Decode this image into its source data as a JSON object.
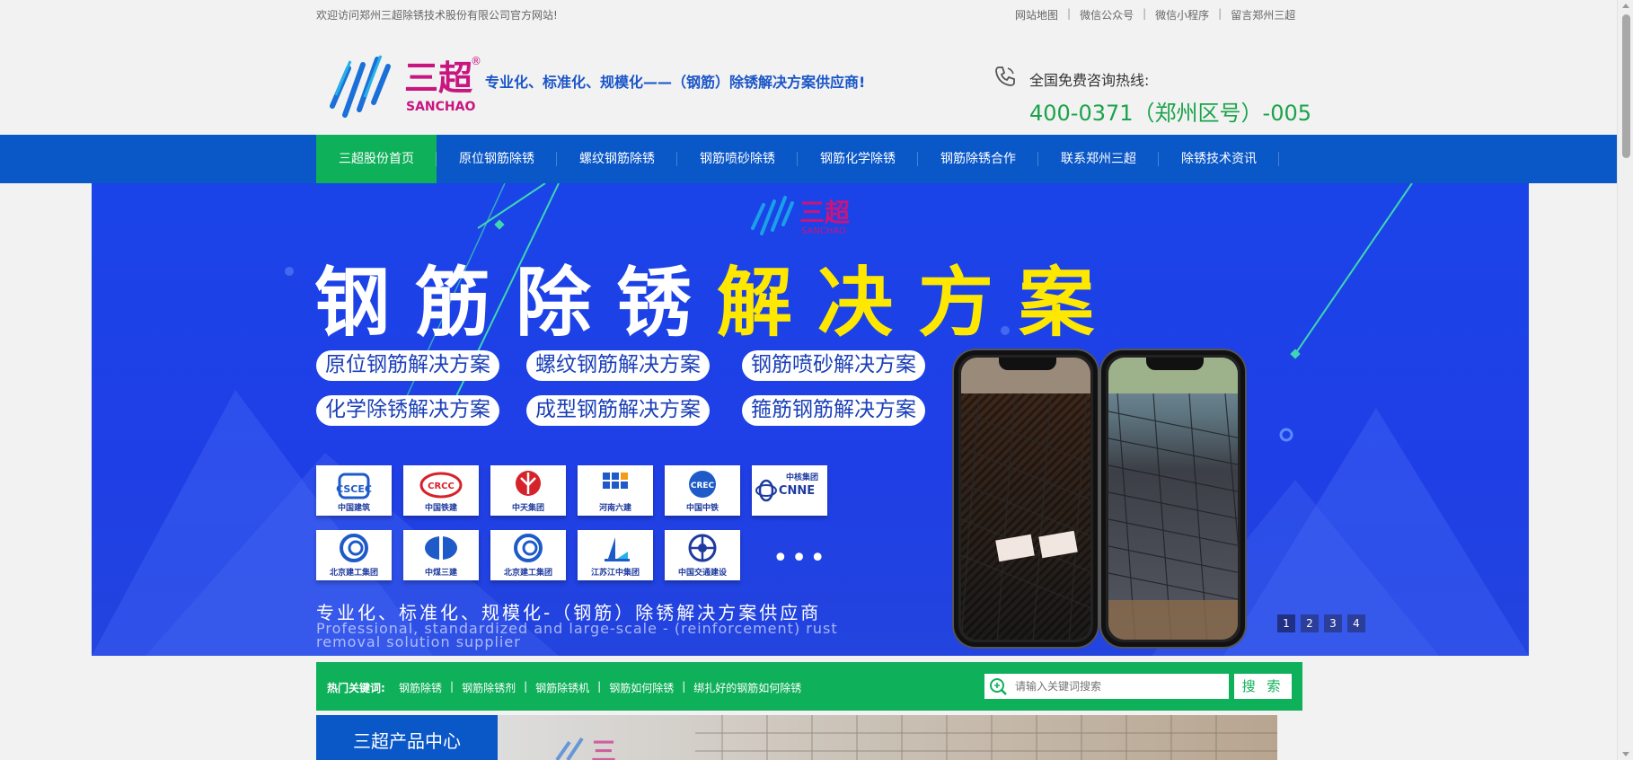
{
  "topbar": {
    "welcome": "欢迎访问郑州三超除锈技术股份有限公司官方网站!",
    "links": [
      "网站地图",
      "微信公众号",
      "微信小程序",
      "留言郑州三超"
    ]
  },
  "header": {
    "logo_text": "三超",
    "logo_sub": "SANCHAO",
    "logo_reg": "®",
    "slogan": "专业化、标准化、规模化——（钢筋）除锈解决方案供应商!",
    "hotline_label": "全国免费咨询热线:",
    "hotline_number": "400-0371（郑州区号）-005"
  },
  "nav": {
    "items": [
      "三超股份首页",
      "原位钢筋除锈",
      "螺纹钢筋除锈",
      "钢筋喷砂除锈",
      "钢筋化学除锈",
      "钢筋除锈合作",
      "联系郑州三超",
      "除锈技术资讯"
    ],
    "active_index": 0
  },
  "banner": {
    "logo_text": "三超",
    "logo_sub": "SANCHAO",
    "headline_white": "钢筋除锈",
    "headline_yellow": "解决方案",
    "pills": [
      "原位钢筋解决方案",
      "螺纹钢筋解决方案",
      "钢筋喷砂解决方案",
      "化学除锈解决方案",
      "成型钢筋解决方案",
      "箍筋钢筋解决方案"
    ],
    "clients": [
      "中国建筑",
      "中国铁建",
      "中天集团",
      "河南六建",
      "中国中铁",
      "中核集团",
      "北京建工集团",
      "中煤三建",
      "北京建工集团",
      "江苏江中集团",
      "中国交通建设"
    ],
    "client_cnne": "CNNE",
    "more": "•••",
    "tagline_cn": "专业化、标准化、规模化-（钢筋）除锈解决方案供应商",
    "tagline_en": "Professional, standardized and large-scale  -  (reinforcement) rust removal solution supplier",
    "pager": [
      "1",
      "2",
      "3",
      "4"
    ],
    "pager_active": 0
  },
  "keywords": {
    "label": "热门关键词:",
    "items": [
      "钢筋除锈",
      "钢筋除锈剂",
      "钢筋除锈机",
      "钢筋如何除锈",
      "绑扎好的钢筋如何除锈"
    ],
    "separator": "|",
    "search_placeholder": "请输入关键词搜索",
    "search_button": "搜 索"
  },
  "products": {
    "tab_label": "三超产品中心"
  },
  "colors": {
    "nav_blue": "#0a57c8",
    "active_green": "#0fb05a",
    "banner_blue": "#1a44e8",
    "headline_yellow": "#ffe800",
    "hotline_green": "#1aa34a",
    "logo_magenta": "#c8157f"
  }
}
